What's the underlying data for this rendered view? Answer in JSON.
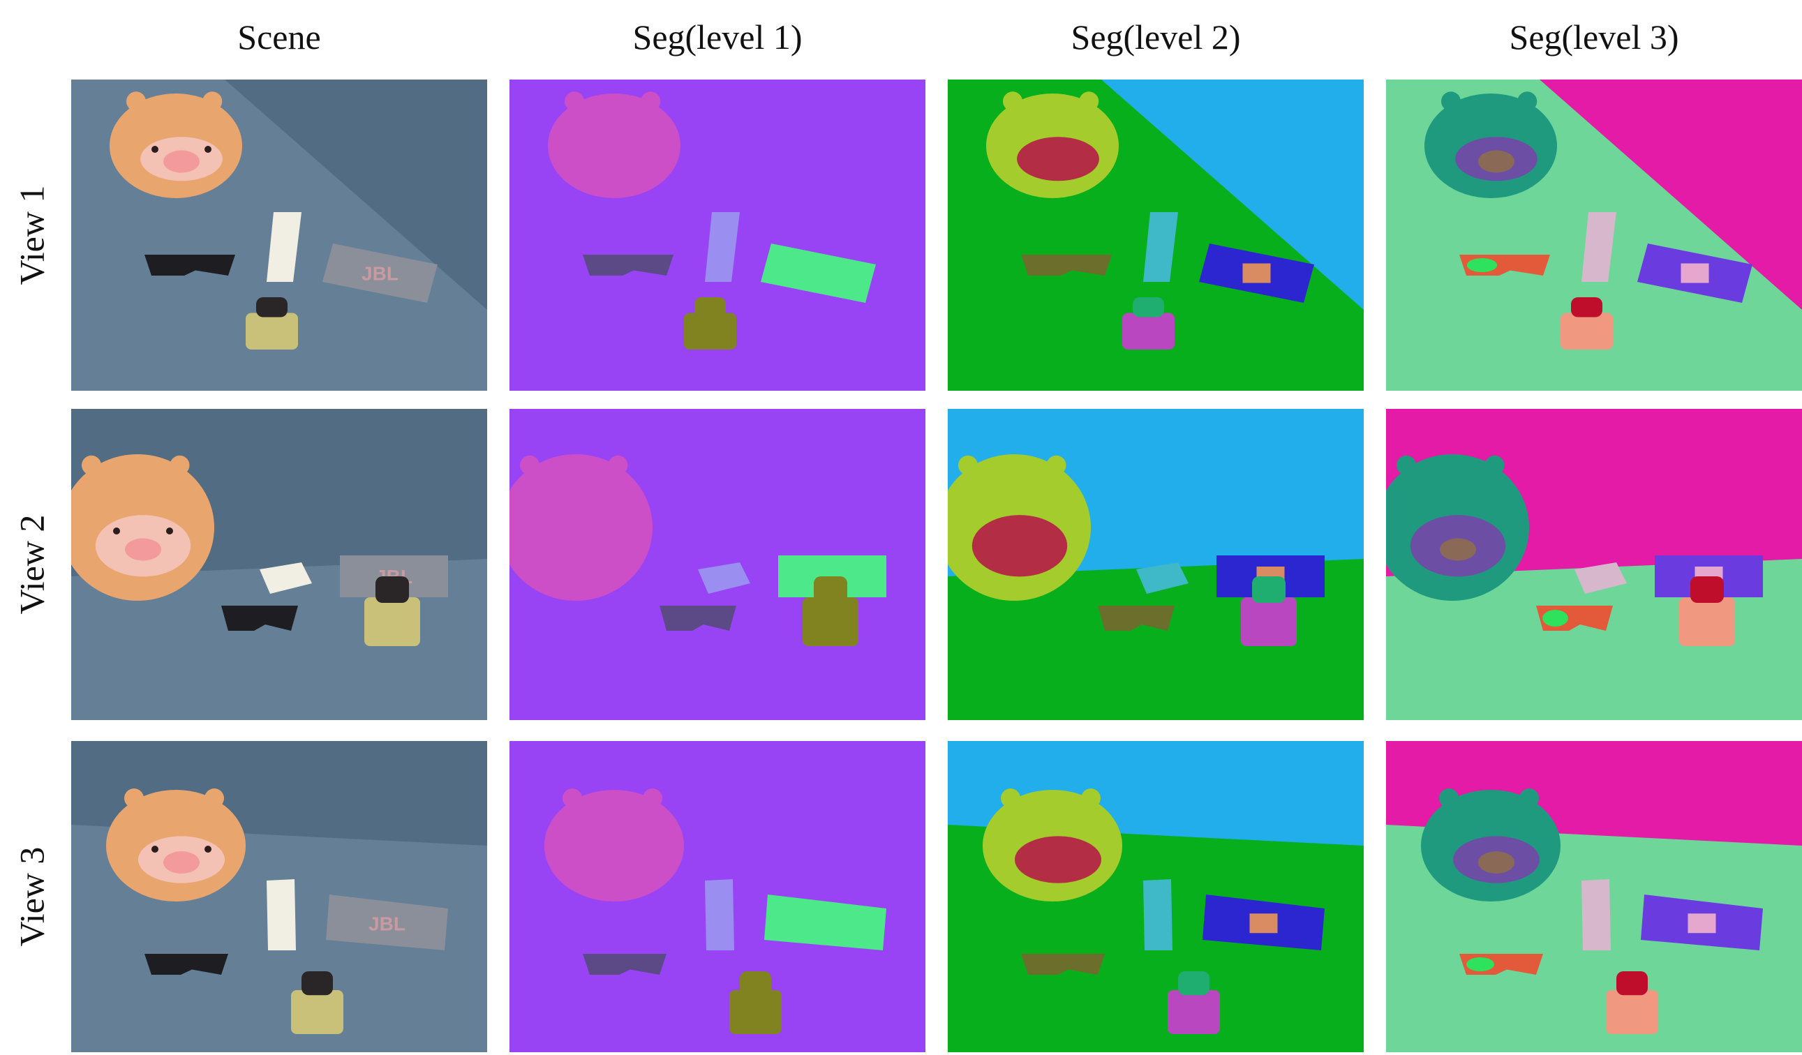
{
  "columns": [
    {
      "label": "Scene"
    },
    {
      "label": "Seg(level 1)"
    },
    {
      "label": "Seg(level 2)"
    },
    {
      "label": "Seg(level 3)"
    }
  ],
  "rows": [
    {
      "label": "View 1"
    },
    {
      "label": "View 2"
    },
    {
      "label": "View 3"
    }
  ],
  "product_text": "JBL",
  "colors": {
    "sofa": "#647f96",
    "level1_background": "#9844f5",
    "level1_plush": "#cc4fc8",
    "level1_remote": "#9a8ef0",
    "level1_glasses": "#5b4a86",
    "level1_speaker": "#4de88a",
    "level1_bottle": "#818320",
    "level2_wall": "#22aeea",
    "level2_seat": "#08af1c",
    "level2_plush": "#a4cc2c",
    "level2_plush_face": "#b32d44",
    "level2_speaker": "#2c26d0",
    "level2_bottle": "#b847c0",
    "level3_wall": "#e31ba6",
    "level3_seat": "#6fd69a",
    "level3_plush": "#1f9a7e",
    "level3_plush_face": "#6c4fa4",
    "level3_speaker": "#6a3ce0",
    "level3_bottle_cap": "#bf0d2c",
    "level3_bottle": "#f19880"
  }
}
